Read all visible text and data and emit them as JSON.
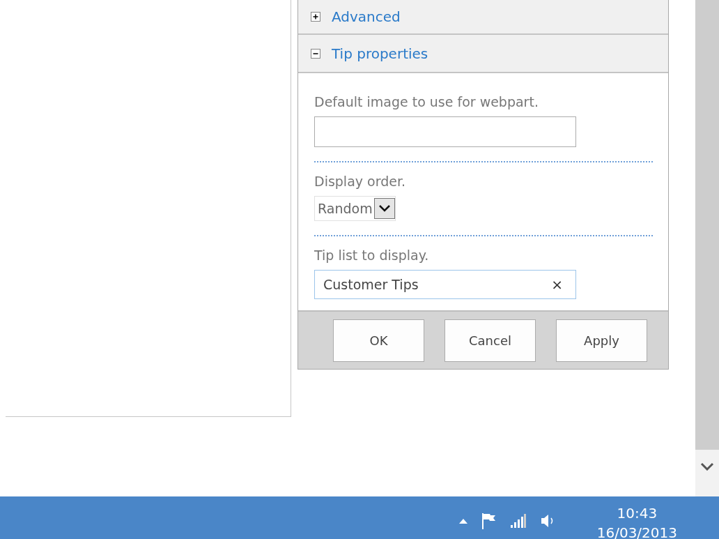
{
  "sections": [
    {
      "title": "Advanced",
      "expanded": false
    },
    {
      "title": "Tip properties",
      "expanded": true
    }
  ],
  "fields": [
    {
      "kind": "text",
      "label": "Default image to use for webpart."
    },
    {
      "kind": "select",
      "label": "Display order.",
      "value": "Random"
    },
    {
      "kind": "lookup",
      "label": "Tip list to display.",
      "value": "Customer Tips",
      "clear": "×"
    }
  ],
  "buttons": [
    "OK",
    "Cancel",
    "Apply"
  ],
  "taskbar": {
    "time": "10:43",
    "date": "16/03/2013"
  }
}
